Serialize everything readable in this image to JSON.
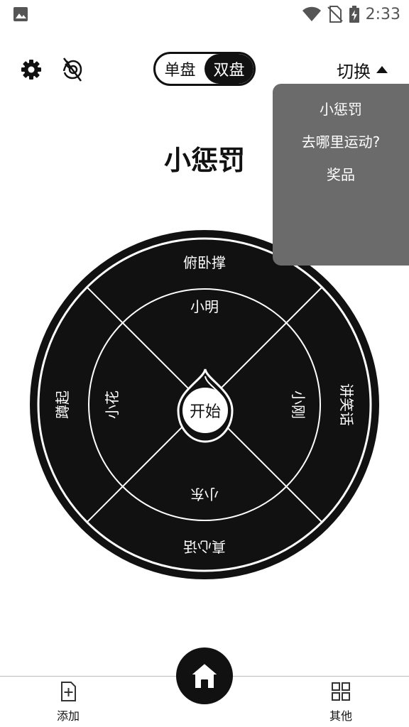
{
  "status_bar": {
    "time": "2:33"
  },
  "top_bar": {
    "mode_single": "单盘",
    "mode_double": "双盘",
    "switch_label": "切换"
  },
  "dropdown": {
    "items": [
      "小惩罚",
      "去哪里运动?",
      "奖品"
    ]
  },
  "title": "小惩罚",
  "wheel": {
    "outer_items": [
      "俯卧撑",
      "讲笑话",
      "真心话",
      "蹲起"
    ],
    "inner_items": [
      "小明",
      "小刚",
      "小东",
      "小花"
    ],
    "start_label": "开始"
  },
  "bottom_nav": {
    "add_label": "添加",
    "other_label": "其他"
  }
}
